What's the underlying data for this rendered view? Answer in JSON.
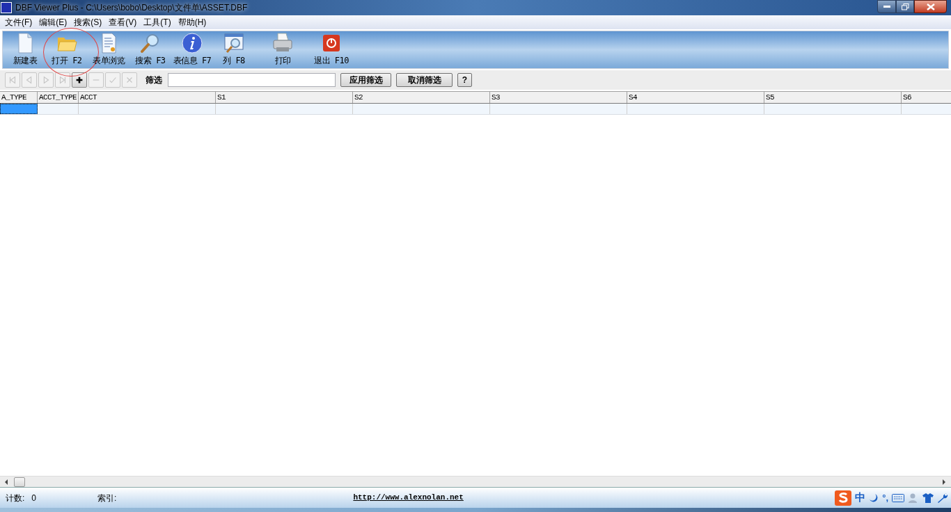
{
  "window": {
    "title": "DBF Viewer Plus - C:\\Users\\bobo\\Desktop\\文件单\\ASSET.DBF"
  },
  "menu": [
    "文件(F)",
    "编辑(E)",
    "搜索(S)",
    "查看(V)",
    "工具(T)",
    "帮助(H)"
  ],
  "toolbar": [
    {
      "kind": "new",
      "label": "新建表",
      "circled": false
    },
    {
      "kind": "open",
      "label": "打开 F2",
      "circled": true
    },
    {
      "kind": "form",
      "label": "表单浏览",
      "circled": false
    },
    {
      "kind": "search",
      "label": "搜索 F3",
      "circled": false
    },
    {
      "kind": "info",
      "label": "表信息 F7",
      "circled": false
    },
    {
      "kind": "columns",
      "label": "列 F8",
      "circled": false
    },
    {
      "kind": "print",
      "label": "打印",
      "circled": false
    },
    {
      "kind": "exit",
      "label": "退出 F10",
      "circled": false
    }
  ],
  "nav_buttons": [
    {
      "kind": "first",
      "disabled": true
    },
    {
      "kind": "prev",
      "disabled": true
    },
    {
      "kind": "next",
      "disabled": true
    },
    {
      "kind": "last",
      "disabled": true
    },
    {
      "kind": "add",
      "disabled": false
    },
    {
      "kind": "remove",
      "disabled": true
    },
    {
      "kind": "confirm",
      "disabled": true
    },
    {
      "kind": "cancel",
      "disabled": true
    }
  ],
  "filter": {
    "label": "筛选",
    "apply": "应用筛选",
    "clear": "取消筛选",
    "help": "?"
  },
  "table": {
    "columns": [
      "A_TYPE",
      "ACCT_TYPE",
      "ACCT",
      "S1",
      "S2",
      "S3",
      "S4",
      "S5",
      "S6"
    ]
  },
  "status_bar": {
    "count_label": "计数:",
    "count": "0",
    "index_label": "索引:",
    "link": "http://www.alexnolan.net"
  },
  "ime": {
    "mode": "中",
    "punct": "°,"
  }
}
